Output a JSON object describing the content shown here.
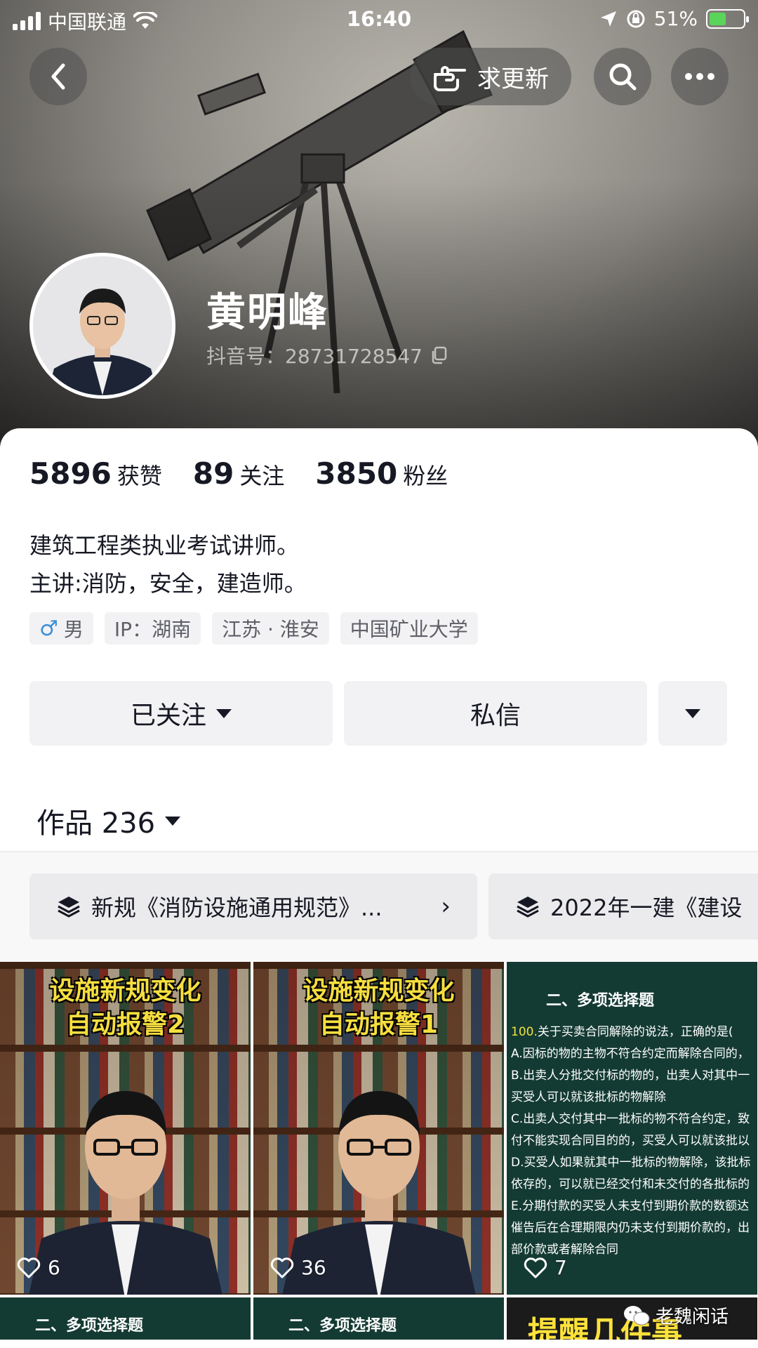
{
  "status_bar": {
    "carrier": "中国联通",
    "time": "16:40",
    "battery": "51%",
    "battery_level": 0.51
  },
  "top_bar": {
    "update_label": "求更新"
  },
  "profile": {
    "nickname": "黄明峰",
    "douyin_id": "抖音号：28731728547"
  },
  "stats": [
    {
      "value": "5896",
      "label": "获赞"
    },
    {
      "value": "89",
      "label": "关注"
    },
    {
      "value": "3850",
      "label": "粉丝"
    }
  ],
  "bio": {
    "line1": "建筑工程类执业考试讲师。",
    "line2": "主讲:消防，安全，建造师。"
  },
  "tags": {
    "gender_symbol": "♂",
    "gender": "男",
    "ip": "IP：湖南",
    "location": "江苏 · 淮安",
    "school": "中国矿业大学"
  },
  "actions": {
    "follow": "已关注",
    "message": "私信"
  },
  "works": {
    "label": "作品 236"
  },
  "collections": [
    {
      "title": "新规《消防设施通用规范》..."
    },
    {
      "title": "2022年一建《建设"
    }
  ],
  "videos": [
    {
      "title_line1": "设施新规变化",
      "title_line2": "自动报警2",
      "likes": "6"
    },
    {
      "title_line1": "设施新规变化",
      "title_line2": "自动报警1",
      "likes": "36"
    },
    {
      "heading": "二、多项选择题",
      "q_num": "100.",
      "q_text": "关于买卖合同解除的说法，正确的是(",
      "lines": [
        "A.因标的物的主物不符合约定而解除合同的，",
        "B.出卖人分批交付标的物的，出卖人对其中一",
        "买受人可以就该批标的物解除",
        "C.出卖人交付其中一批标的物不符合约定，致",
        "付不能实现合同目的的，买受人可以就该批以",
        "D.买受人如果就其中一批标的物解除，该批标",
        "依存的，可以就已经交付和未交付的各批标的",
        "E.分期付款的买受人未支付到期价款的数额达",
        "催告后在合理期限内仍未支付到期价款的，出",
        "部价款或者解除合同"
      ],
      "likes": "7"
    }
  ],
  "row2": [
    {
      "heading": "二、多项选择题"
    },
    {
      "heading": "二、多项选择题"
    },
    {
      "heading": "提醒几件事"
    }
  ],
  "watermark": "老魏闲话"
}
